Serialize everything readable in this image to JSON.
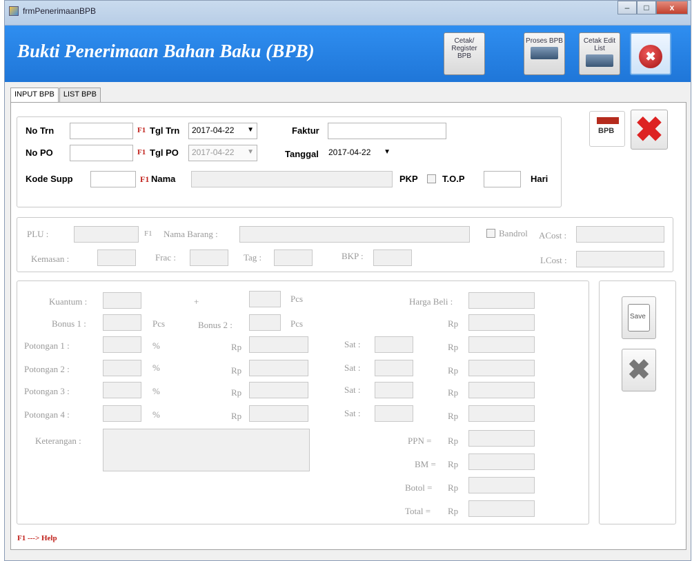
{
  "window": {
    "title": "frmPenerimaanBPB",
    "min": "–",
    "max": "□",
    "close": "x"
  },
  "header": {
    "title": "Bukti Penerimaan Bahan Baku (BPB)",
    "buttons": {
      "cetak_register": "Cetak/ Register BPB",
      "proses_bpb": "Proses BPB",
      "cetak_edit_list": "Cetak Edit List"
    }
  },
  "tabs": [
    "INPUT BPB",
    "LIST BPB"
  ],
  "header_group": {
    "no_trn_label": "No Trn",
    "f1": "F1",
    "tgl_trn_label": "Tgl Trn",
    "tgl_trn": "2017-04-22",
    "faktur_label": "Faktur",
    "no_po_label": "No PO",
    "tgl_po_label": "Tgl PO",
    "tgl_po": "2017-04-22",
    "tanggal_label": "Tanggal",
    "tanggal": "2017-04-22",
    "kode_supp_label": "Kode Supp",
    "nama_label": "Nama",
    "pkp_label": "PKP",
    "top_label": "T.O.P",
    "hari_label": "Hari",
    "bpb_btn": "BPB"
  },
  "item_group": {
    "plu": "PLU :",
    "f1": "F1",
    "nama_barang": "Nama Barang :",
    "bandrol": "Bandrol",
    "acost": "ACost :",
    "kemasan": "Kemasan :",
    "frac": "Frac :",
    "tag": "Tag :",
    "bkp": "BKP :",
    "lcost": "LCost :"
  },
  "detail_group": {
    "kuantum": "Kuantum :",
    "plus": "+",
    "pcs": "Pcs",
    "harga_beli": "Harga Beli :",
    "bonus1": "Bonus 1 :",
    "bonus2": "Bonus 2 :",
    "rp": "Rp",
    "pot1": "Potongan 1 :",
    "pot2": "Potongan 2 :",
    "pot3": "Potongan 3 :",
    "pot4": "Potongan 4 :",
    "pct": "%",
    "sat": "Sat :",
    "keterangan": "Keterangan :",
    "ppn": "PPN =",
    "bm": "BM =",
    "botol": "Botol =",
    "total": "Total ="
  },
  "side": {
    "save": "Save"
  },
  "footer": {
    "help": "F1 ---> Help"
  }
}
